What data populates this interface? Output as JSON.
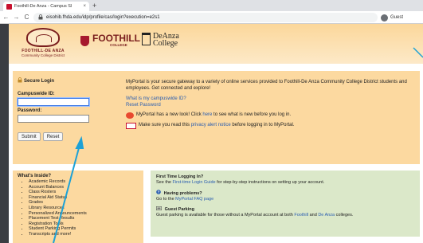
{
  "browser": {
    "tab_title": "Foothill-De Anza - Campus Sl",
    "tab_close": "×",
    "new_tab": "+",
    "back": "←",
    "forward": "→",
    "reload": "C",
    "url": "eisohib.fhda.edu/idp/profile/cas/login?execution=e2s1",
    "profile_label": "Guest"
  },
  "header": {
    "fhda_line1": "FOOTHILL-DE ANZA",
    "fhda_line2": "Community College District",
    "foothill_name": "FOOTHILL",
    "foothill_sub": "COLLEGE",
    "deanza_line1": "DeAnza",
    "deanza_line2": "College"
  },
  "login": {
    "heading": "Secure Login",
    "campuswide_label": "Campuswide ID:",
    "password_label": "Password:",
    "submit_label": "Submit",
    "reset_label": "Reset"
  },
  "info": {
    "intro": "MyPortal is your secure gateway to a variety of online services provided to Foothill-De Anza Community College District students and employees. Get connected and explore!",
    "what_is_link": "What is my campuswide ID?",
    "reset_password_link": "Reset Password",
    "new_look_pre": "MyPortal has a new look! Click ",
    "new_look_link": "here",
    "new_look_post": " to see what is new before you log in.",
    "privacy_pre": "Make sure you read this ",
    "privacy_link": "privacy alert notice",
    "privacy_post": " before logging in to MyPortal."
  },
  "whats_inside": {
    "title": "What's Inside?",
    "items": [
      "Academic Records",
      "Account Balances",
      "Class Rosters",
      "Financial Aid Status",
      "Grades",
      "Library Resources",
      "Personalized Announcements",
      "Placement Test Results",
      "Registration Tools",
      "Student Parking Permits",
      "Transcripts and more!"
    ]
  },
  "help": {
    "first_time_title": "First Time Logging In?",
    "first_time_pre": "See the ",
    "first_time_link": "First-time Login Guide",
    "first_time_post": " for step-by-step instructions on setting up your account.",
    "problems_title": "Having problems?",
    "problems_pre": "Go to the ",
    "problems_link": "MyPortal FAQ page",
    "parking_title": "Guest Parking",
    "parking_pre": "Guest parking is available for those without a MyPortal account at both ",
    "parking_link1": "Foothill",
    "parking_mid": " and ",
    "parking_link2": "De Anza",
    "parking_post": " colleges."
  },
  "colors": {
    "arrow": "#1da1d6",
    "panel": "#fcd9a0",
    "green_panel": "#dbe8c9",
    "link": "#2a5db0"
  },
  "icons": {
    "lock": "lock-icon",
    "starburst": "new-starburst-icon",
    "privacy": "privacy-alert-icon",
    "help": "question-icon",
    "parking": "parking-icon"
  }
}
